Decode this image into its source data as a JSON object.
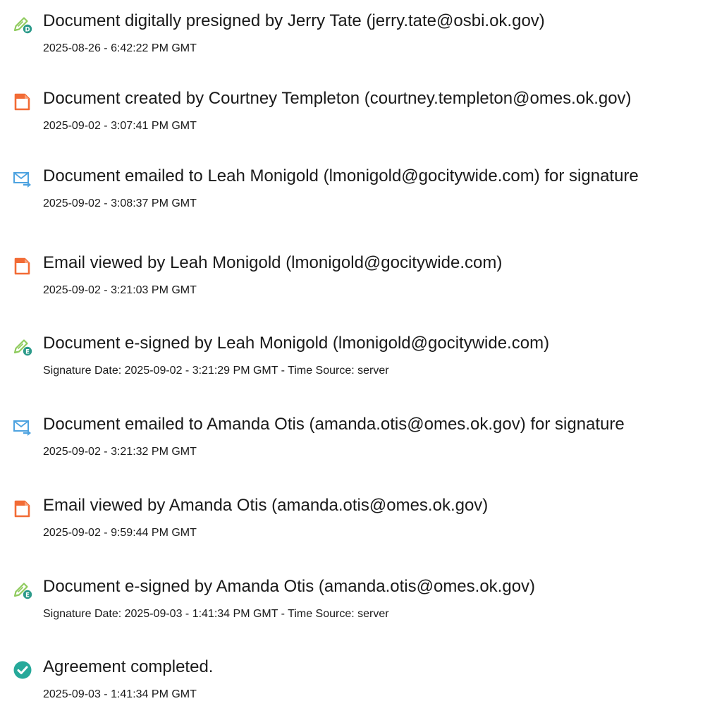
{
  "events": [
    {
      "icon": "pen-d-icon",
      "title": "Document digitally presigned by Jerry Tate (jerry.tate@osbi.ok.gov)",
      "time": "2025-08-26 - 6:42:22 PM GMT"
    },
    {
      "icon": "document-icon",
      "title": "Document created by Courtney Templeton (courtney.templeton@omes.ok.gov)",
      "time": "2025-09-02 - 3:07:41 PM GMT"
    },
    {
      "icon": "email-send-icon",
      "title": "Document emailed to Leah Monigold (lmonigold@gocitywide.com) for signature",
      "time": "2025-09-02 - 3:08:37 PM GMT"
    },
    {
      "icon": "document-icon",
      "title": "Email viewed by Leah Monigold (lmonigold@gocitywide.com)",
      "time": "2025-09-02 - 3:21:03 PM GMT"
    },
    {
      "icon": "pen-e-icon",
      "title": "Document e-signed by Leah Monigold (lmonigold@gocitywide.com)",
      "time": "Signature Date: 2025-09-02 - 3:21:29 PM GMT - Time Source: server"
    },
    {
      "icon": "email-send-icon",
      "title": "Document emailed to Amanda Otis (amanda.otis@omes.ok.gov) for signature",
      "time": "2025-09-02 - 3:21:32 PM GMT"
    },
    {
      "icon": "document-icon",
      "title": "Email viewed by Amanda Otis (amanda.otis@omes.ok.gov)",
      "time": "2025-09-02 - 9:59:44 PM GMT"
    },
    {
      "icon": "pen-e-icon",
      "title": "Document e-signed by Amanda Otis (amanda.otis@omes.ok.gov)",
      "time": "Signature Date: 2025-09-03 - 1:41:34 PM GMT - Time Source: server"
    },
    {
      "icon": "checkmark-circle-icon",
      "title": "Agreement completed.",
      "time": "2025-09-03 - 1:41:34 PM GMT"
    }
  ],
  "colors": {
    "pen": "#8fcb5e",
    "badge": "#2c9a8a",
    "document": "#f26b35",
    "email": "#4ea3e0",
    "check": "#26a99a",
    "text": "#1a1a1a"
  }
}
